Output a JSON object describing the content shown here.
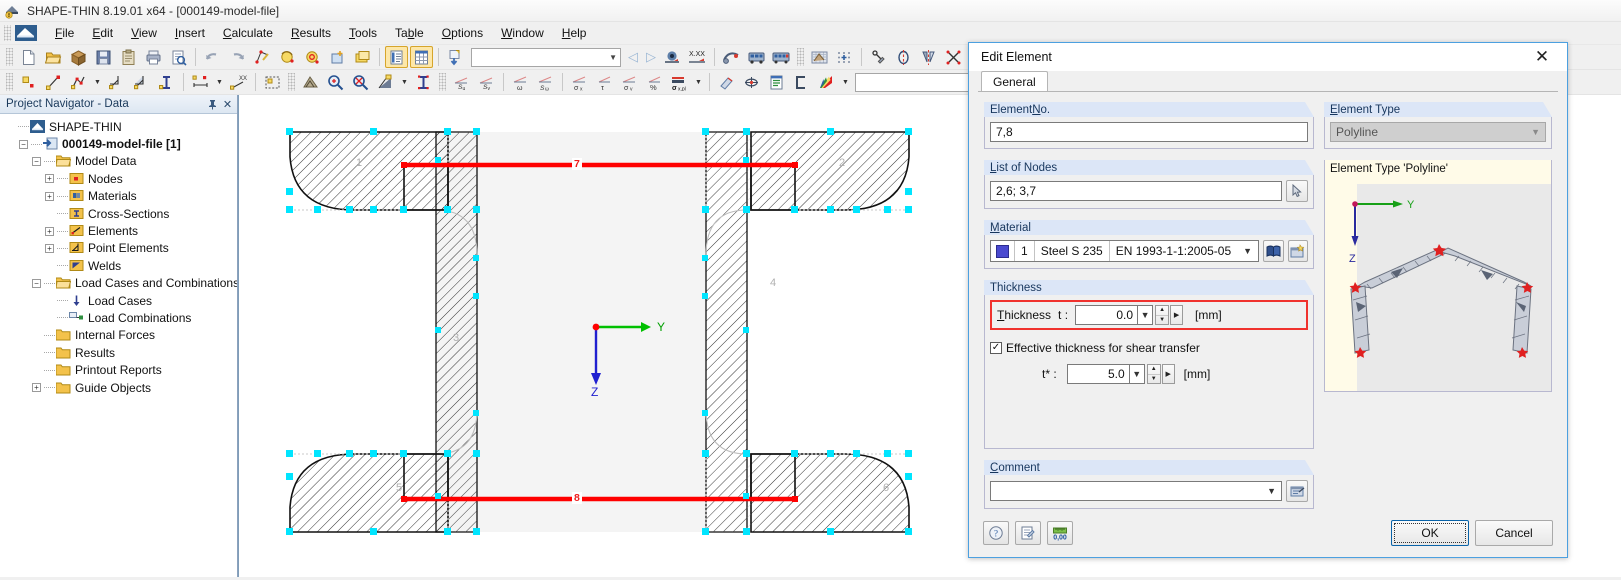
{
  "window": {
    "title": "SHAPE-THIN 8.19.01 x64 - [000149-model-file]",
    "app_icon": "shape-thin-app-icon"
  },
  "menubar": {
    "items": [
      {
        "label": "File",
        "accel": "F"
      },
      {
        "label": "Edit",
        "accel": "E"
      },
      {
        "label": "View",
        "accel": "V"
      },
      {
        "label": "Insert",
        "accel": "I"
      },
      {
        "label": "Calculate",
        "accel": "C"
      },
      {
        "label": "Results",
        "accel": "R"
      },
      {
        "label": "Tools",
        "accel": "T"
      },
      {
        "label": "Table",
        "accel": "b"
      },
      {
        "label": "Options",
        "accel": "O"
      },
      {
        "label": "Window",
        "accel": "W"
      },
      {
        "label": "Help",
        "accel": "H"
      }
    ]
  },
  "toolbar1": {
    "buttons": [
      "new-file-icon",
      "open-file-icon",
      "open-package-icon",
      "save-icon",
      "clipboard-icon",
      "print-icon",
      "print-preview-icon",
      "undo-icon",
      "redo-icon",
      "edit-section-icon",
      "rotate-left-icon",
      "rotate-right-icon",
      "add-window-icon",
      "new-view-icon",
      "table-list-icon",
      "table-grid-icon",
      "import-icon"
    ],
    "combo_value": "",
    "nav_prev": "prev-arrow-icon",
    "nav_next": "next-arrow-icon",
    "view_buttons": [
      "visibility-icon",
      "xxx-value-icon",
      "render-icon",
      "bus-icon",
      "bus-multi-icon"
    ],
    "snap_buttons": [
      "grid-snap-icon",
      "grid-points-icon",
      "object-snap-icon",
      "rotate-axis-icon",
      "mirror-icon",
      "intersect-icon",
      "info-icon",
      "photo-icon",
      "settings-gear-icon"
    ]
  },
  "toolbar2": {
    "buttons": [
      "new-node-icon",
      "new-line-element-icon",
      "new-polyline-icon",
      "new-point-element-icon",
      "new-point-element2-icon",
      "new-cross-section-icon",
      "dimension-icon",
      "xx-node-icon",
      "select-region-icon",
      "mesh-icon",
      "zoom-in-icon",
      "zoom-out-icon",
      "fill-icon",
      "text-icon"
    ],
    "result_buttons": [
      "su-icon",
      "sv-icon",
      "omega-icon",
      "s-omega-icon",
      "sigma-x-icon",
      "tau-icon",
      "sigma-v-icon",
      "percent-icon",
      "sigma-x-pl-icon"
    ],
    "extra_buttons": [
      "eraser-icon",
      "center-icon",
      "report-icon",
      "bracket-icon",
      "color-palette-icon"
    ],
    "combo_value": "",
    "nav_prev": "prev-arrow-icon",
    "nav_next": "next-arrow-icon"
  },
  "navigator": {
    "title": "Project Navigator - Data",
    "pin_icon": "pin-icon",
    "close_icon": "close-icon",
    "tree": [
      {
        "label": "SHAPE-THIN",
        "depth": 0,
        "toggle": "none",
        "icon": "shape-thin-icon",
        "bold": false
      },
      {
        "label": "000149-model-file [1]",
        "depth": 1,
        "toggle": "minus",
        "icon": "model-file-icon",
        "bold": true
      },
      {
        "label": "Model Data",
        "depth": 2,
        "toggle": "minus",
        "icon": "folder-open-icon",
        "bold": false
      },
      {
        "label": "Nodes",
        "depth": 3,
        "toggle": "plus",
        "icon": "nodes-icon",
        "bold": false
      },
      {
        "label": "Materials",
        "depth": 3,
        "toggle": "plus",
        "icon": "materials-icon",
        "bold": false
      },
      {
        "label": "Cross-Sections",
        "depth": 3,
        "toggle": "none",
        "icon": "cross-sections-icon",
        "bold": false
      },
      {
        "label": "Elements",
        "depth": 3,
        "toggle": "plus",
        "icon": "elements-icon",
        "bold": false
      },
      {
        "label": "Point Elements",
        "depth": 3,
        "toggle": "plus",
        "icon": "point-elements-icon",
        "bold": false
      },
      {
        "label": "Welds",
        "depth": 3,
        "toggle": "none",
        "icon": "welds-icon",
        "bold": false
      },
      {
        "label": "Load Cases and Combinations",
        "depth": 2,
        "toggle": "minus",
        "icon": "folder-open-icon",
        "bold": false
      },
      {
        "label": "Load Cases",
        "depth": 3,
        "toggle": "none",
        "icon": "load-cases-icon",
        "bold": false
      },
      {
        "label": "Load Combinations",
        "depth": 3,
        "toggle": "none",
        "icon": "load-combinations-icon",
        "bold": false
      },
      {
        "label": "Internal Forces",
        "depth": 2,
        "toggle": "none",
        "icon": "folder-icon",
        "bold": false
      },
      {
        "label": "Results",
        "depth": 2,
        "toggle": "none",
        "icon": "folder-icon",
        "bold": false
      },
      {
        "label": "Printout Reports",
        "depth": 2,
        "toggle": "none",
        "icon": "folder-icon",
        "bold": false
      },
      {
        "label": "Guide Objects",
        "depth": 2,
        "toggle": "plus",
        "icon": "folder-icon",
        "bold": false
      }
    ]
  },
  "cad": {
    "axis_y_label": "Y",
    "axis_z_label": "Z",
    "element_numbers": [
      "1",
      "2",
      "3",
      "4",
      "5",
      "6"
    ],
    "selected_element_labels": [
      "7",
      "8"
    ],
    "colors": {
      "selection_handle": "#00e5ff",
      "selected_element": "#ff0000",
      "axis_y": "#00c000",
      "axis_z": "#2020d0",
      "origin_point": "#ff0000"
    }
  },
  "dialog": {
    "title": "Edit Element",
    "close_icon": "close-icon",
    "tabs": [
      {
        "label": "General",
        "active": true
      }
    ],
    "element_no": {
      "label": "Element No.",
      "accel": "N",
      "value": "7,8"
    },
    "list_of_nodes": {
      "label": "List of Nodes",
      "accel": "L",
      "value": "2,6; 3,7",
      "pick_button_icon": "pick-cursor-icon"
    },
    "material": {
      "label": "Material",
      "accel": "M",
      "color": "#4a4ad0",
      "number": "1",
      "name": "Steel S 235",
      "standard": "EN 1993-1-1:2005-05",
      "dropdown_icon": "chevron-down-icon",
      "library_button_icon": "material-library-icon",
      "new_button_icon": "new-material-icon"
    },
    "thickness": {
      "label": "Thickness",
      "t_label": "Thickness",
      "t_accel": "T",
      "t_symbol": "t :",
      "t_value": "0.0",
      "t_unit": "[mm]",
      "highlight_color": "#f0322e",
      "effective_checkbox_label": "Effective thickness for shear transfer",
      "effective_checked": true,
      "t_star_symbol": "t* :",
      "t_star_value": "5.0",
      "t_star_unit": "[mm]"
    },
    "comment": {
      "label": "Comment",
      "accel": "C",
      "value": "",
      "dropdown_icon": "chevron-down-icon",
      "button_icon": "comment-picker-icon"
    },
    "element_type": {
      "label": "Element Type",
      "accel": "E",
      "value": "Polyline",
      "preview_title": "Element Type 'Polyline'",
      "preview_axis_y": "Y",
      "preview_axis_z": "Z"
    },
    "footer": {
      "help_icon": "help-icon",
      "edit_icon": "edit-note-icon",
      "units_icon": "units-ruler-icon",
      "ok_label": "OK",
      "cancel_label": "Cancel"
    }
  }
}
